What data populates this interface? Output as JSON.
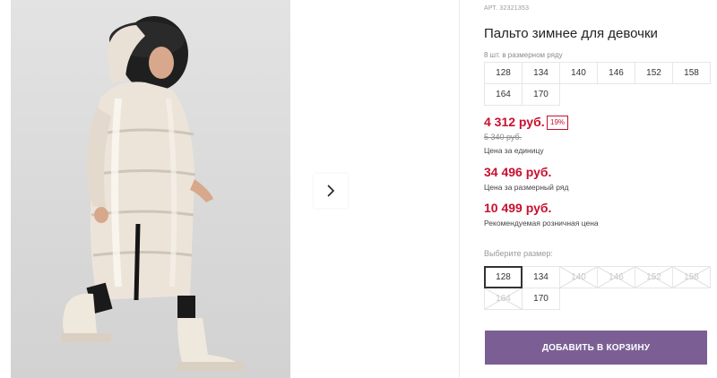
{
  "product": {
    "sku": "АРТ. 32321353",
    "title": "Пальто зимнее для девочки"
  },
  "size_row": {
    "note": "8 шт. в размерном ряду",
    "sizes": [
      "128",
      "134",
      "140",
      "146",
      "152",
      "158",
      "164",
      "170"
    ]
  },
  "pricing": {
    "unit_price": "4 312 руб.",
    "discount_badge": "19%",
    "old_price": "5 340 руб.",
    "unit_label": "Цена за единицу",
    "row_price": "34 496 руб.",
    "row_label": "Цена за размерный ряд",
    "retail_price": "10 499 руб.",
    "retail_label": "Рекомендуемая розничная цена"
  },
  "size_picker": {
    "label": "Выберите размер:",
    "options": [
      {
        "size": "128",
        "state": "selected"
      },
      {
        "size": "134",
        "state": "available"
      },
      {
        "size": "140",
        "state": "disabled"
      },
      {
        "size": "146",
        "state": "disabled"
      },
      {
        "size": "152",
        "state": "disabled"
      },
      {
        "size": "158",
        "state": "disabled"
      },
      {
        "size": "164",
        "state": "disabled"
      },
      {
        "size": "170",
        "state": "available"
      }
    ]
  },
  "actions": {
    "add_to_cart": "ДОБАВИТЬ В КОРЗИНУ"
  },
  "gallery": {
    "next_icon": "chevron-right-icon",
    "photo_subject": "girl-in-winter-coat"
  },
  "colors": {
    "price_red": "#c8102e",
    "cart_button": "#7b5f94"
  }
}
